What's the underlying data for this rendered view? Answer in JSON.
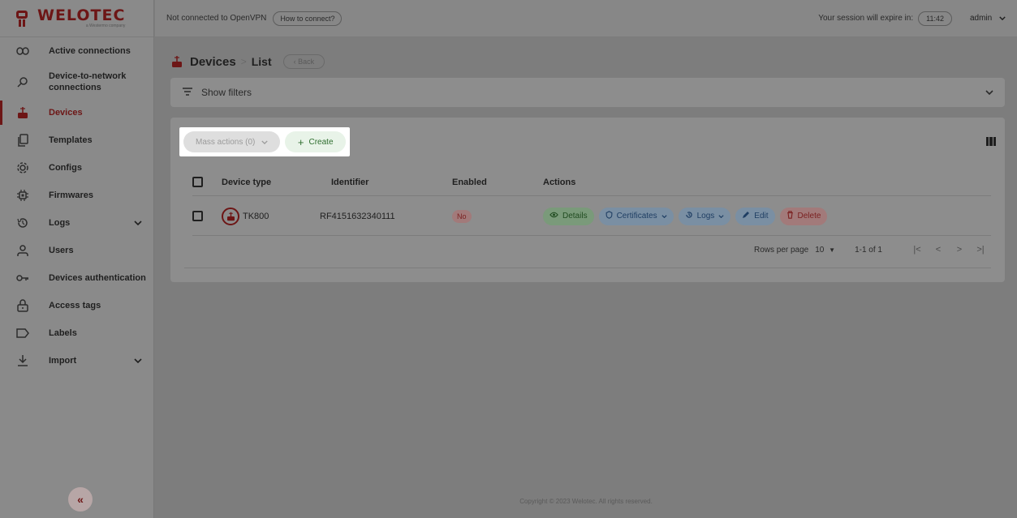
{
  "brand": {
    "name": "WELOTEC",
    "tagline": "a Westermo company"
  },
  "topbar": {
    "vpn_status": "Not connected to OpenVPN",
    "how_to_connect": "How to connect?",
    "session_label": "Your session will expire in:",
    "session_time": "11:42",
    "user": "admin"
  },
  "sidebar": {
    "items": [
      {
        "label": "Active connections"
      },
      {
        "label": "Device-to-network connections"
      },
      {
        "label": "Devices"
      },
      {
        "label": "Templates"
      },
      {
        "label": "Configs"
      },
      {
        "label": "Firmwares"
      },
      {
        "label": "Logs"
      },
      {
        "label": "Users"
      },
      {
        "label": "Devices authentication"
      },
      {
        "label": "Access tags"
      },
      {
        "label": "Labels"
      },
      {
        "label": "Import"
      }
    ],
    "collapse": "«"
  },
  "page": {
    "title": "Devices",
    "separator": ">",
    "subtitle": "List",
    "back": "‹ Back"
  },
  "filters": {
    "label": "Show filters"
  },
  "toolbar": {
    "mass_actions": "Mass actions (0)",
    "create": "Create"
  },
  "table": {
    "headers": [
      "Device type",
      "Identifier",
      "Enabled",
      "Actions"
    ],
    "rows": [
      {
        "type": "TK800",
        "identifier": "RF4151632340111",
        "enabled": "No"
      }
    ],
    "actions": {
      "details": "Details",
      "certificates": "Certificates",
      "logs": "Logs",
      "edit": "Edit",
      "delete": "Delete"
    }
  },
  "pagination": {
    "rows_per_page_label": "Rows per page",
    "rows_per_page": "10",
    "range": "1-1 of 1"
  },
  "footer": "Copyright © 2023 Welotec. All rights reserved."
}
